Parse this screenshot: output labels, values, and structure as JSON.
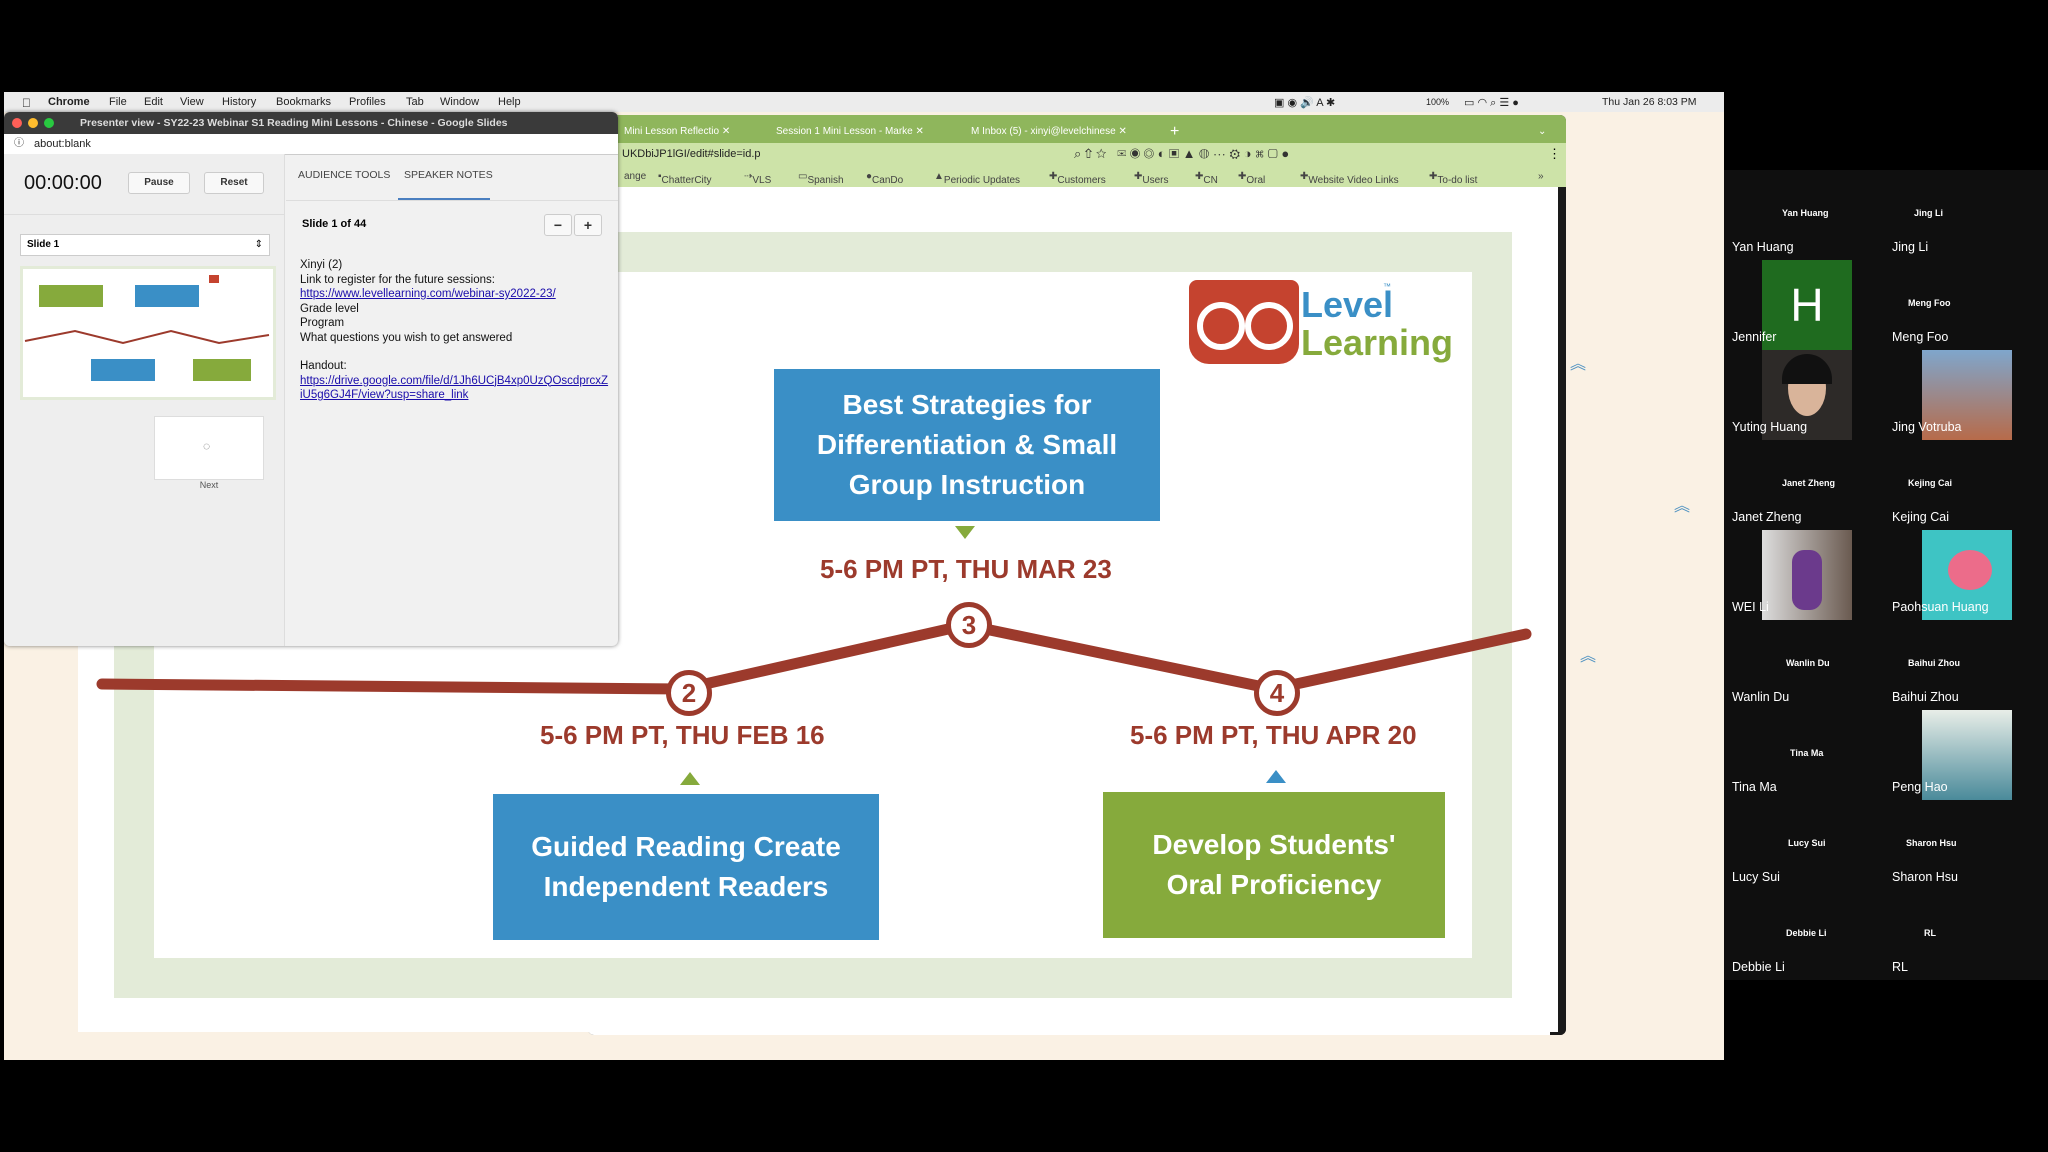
{
  "menubar": {
    "app": "Chrome",
    "items": [
      "File",
      "Edit",
      "View",
      "History",
      "Bookmarks",
      "Profiles",
      "Tab",
      "Window",
      "Help"
    ],
    "battery": "100%",
    "datetime": "Thu Jan 26  8:03 PM"
  },
  "browser": {
    "tabs": [
      "Mini Lesson Reflectio",
      "Session 1 Mini Lesson - Marke",
      "Inbox (5) - xinyi@levelchinese"
    ],
    "new_tab": "+",
    "url": "UKDbiJP1lGI/edit#slide=id.p",
    "bookmarks": [
      "ange",
      "ChatterCity",
      "VLS",
      "Spanish",
      "CanDo",
      "Periodic Updates",
      "Customers",
      "Users",
      "CN",
      "Oral",
      "Website Video Links",
      "To-do list"
    ],
    "more": "»"
  },
  "slide": {
    "logo": {
      "line1": "Level",
      "line2": "Learning",
      "tm": "™"
    },
    "sessions": [
      {
        "num": "3",
        "title": "Best Strategies for Differentiation & Small Group Instruction",
        "date": "5-6 PM PT, THU MAR 23"
      },
      {
        "num": "2",
        "title": "Guided Reading Create Independent Readers",
        "date": "5-6 PM PT, THU FEB 16"
      },
      {
        "num": "4",
        "title": "Develop Students' Oral Proficiency",
        "date": "5-6 PM PT, THU APR 20"
      }
    ],
    "colors": {
      "blue": "#3a8fc6",
      "green": "#86aa3c",
      "red": "#9c3a2c",
      "frame": "#e3ebd8"
    }
  },
  "presenter": {
    "title": "Presenter view - SY22-23 Webinar S1 Reading Mini Lessons - Chinese - Google Slides",
    "url": "about:blank",
    "timer": "00:00:00",
    "pause": "Pause",
    "reset": "Reset",
    "slide_select": "Slide 1",
    "next_label": "Next",
    "tabs": [
      "AUDIENCE TOOLS",
      "SPEAKER NOTES"
    ],
    "slide_counter": "Slide 1 of 44",
    "notes": {
      "lines": [
        "Xinyi (2)",
        "Link to register for the future sessions:"
      ],
      "link1": "https://www.levellearning.com/webinar-sy2022-23/",
      "lines2": [
        "Grade level",
        "Program",
        "What questions you wish to get answered"
      ],
      "handout_label": "Handout:",
      "link2": "https://drive.google.com/file/d/1Jh6UCjB4xp0UzQOscdprcxZiU5g6GJ4F/view?usp=share_link"
    }
  },
  "participants": [
    {
      "top": "Yan Huang",
      "name": "Yan Huang"
    },
    {
      "top": "Jing Li",
      "name": "Jing Li"
    },
    {
      "top": "",
      "name": "Jennifer",
      "initial": "H"
    },
    {
      "top": "Meng Foo",
      "name": "Meng Foo"
    },
    {
      "top": "",
      "name": "Yuting Huang"
    },
    {
      "top": "",
      "name": "Jing Votruba"
    },
    {
      "top": "Janet Zheng",
      "name": "Janet Zheng"
    },
    {
      "top": "Kejing Cai",
      "name": "Kejing Cai"
    },
    {
      "top": "",
      "name": "WEI Li"
    },
    {
      "top": "",
      "name": "Paohsuan Huang"
    },
    {
      "top": "Wanlin Du",
      "name": "Wanlin Du"
    },
    {
      "top": "Baihui Zhou",
      "name": "Baihui Zhou"
    },
    {
      "top": "Tina Ma",
      "name": "Tina Ma"
    },
    {
      "top": "",
      "name": "Peng Hao"
    },
    {
      "top": "Lucy Sui",
      "name": "Lucy Sui"
    },
    {
      "top": "Sharon Hsu",
      "name": "Sharon Hsu"
    },
    {
      "top": "Debbie Li",
      "name": "Debbie Li"
    },
    {
      "top": "RL",
      "name": "RL"
    }
  ]
}
